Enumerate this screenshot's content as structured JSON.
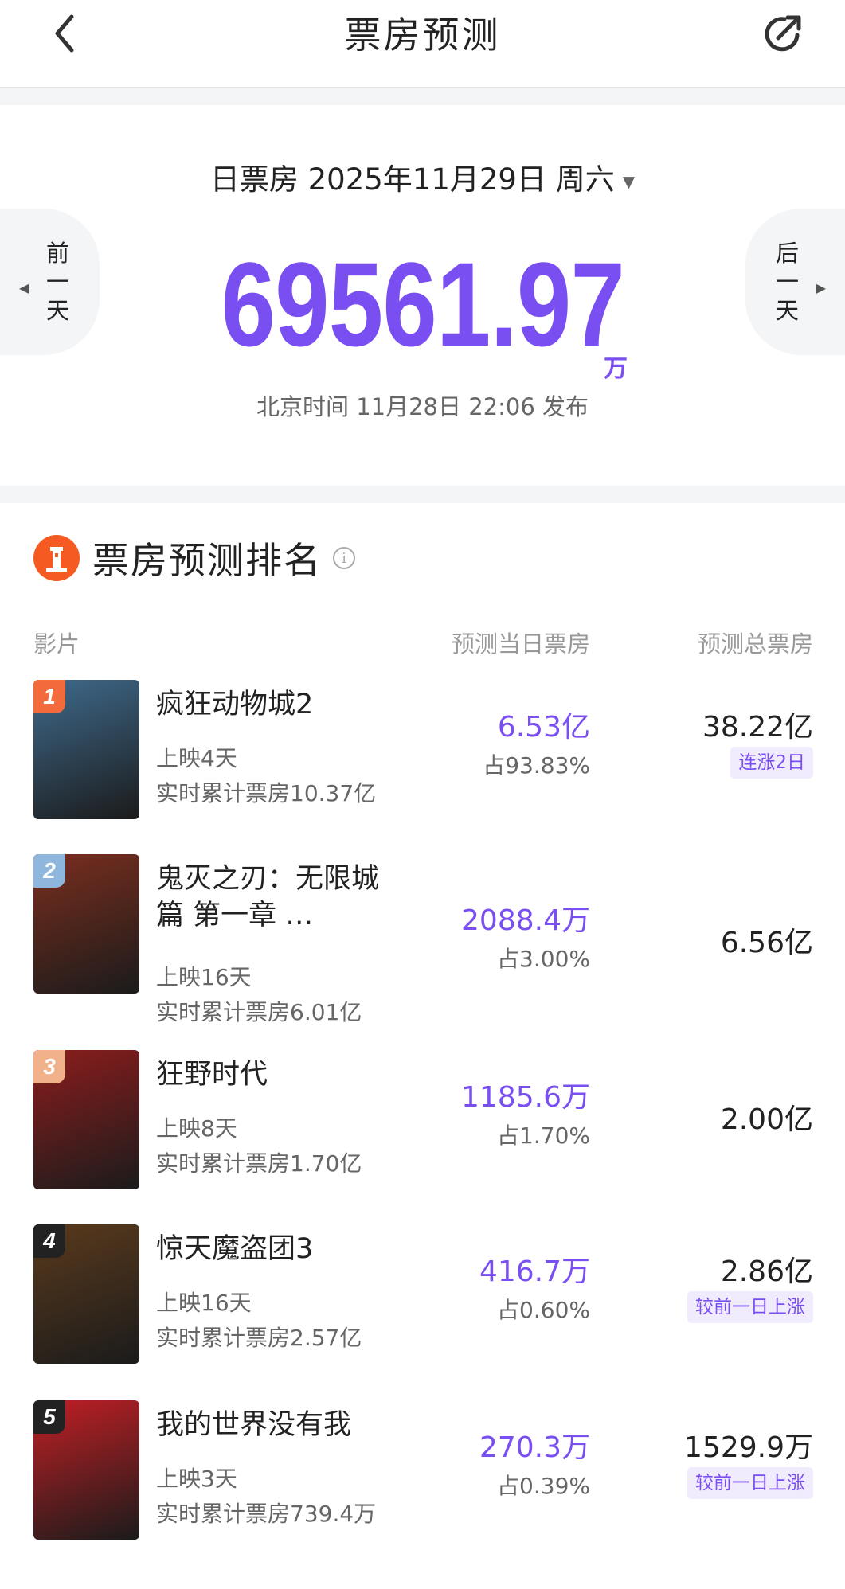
{
  "header": {
    "title": "票房预测"
  },
  "summary": {
    "date": "日票房 2025年11月29日 周六",
    "value": "69561.97",
    "unit": "万",
    "publish": "北京时间 11月28日 22:06 发布",
    "prev_day": [
      "前",
      "一",
      "天"
    ],
    "next_day": [
      "后",
      "一",
      "天"
    ]
  },
  "ranking": {
    "title": "票房预测排名",
    "columns": {
      "film": "影片",
      "day": "预测当日票房",
      "total": "预测总票房"
    },
    "films": [
      {
        "rank": "1",
        "name": "疯狂动物城2",
        "days": "上映4天",
        "cumulative": "实时累计票房10.37亿",
        "day_value": "6.53亿",
        "day_pct": "占93.83%",
        "total": "38.22亿",
        "tag": "连涨2日",
        "badge_color": "#f36b3c",
        "poster_color": "#3f6a8c"
      },
      {
        "rank": "2",
        "name": "鬼灭之刃：无限城篇 第一章 …",
        "days": "上映16天",
        "cumulative": "实时累计票房6.01亿",
        "day_value": "2088.4万",
        "day_pct": "占3.00%",
        "total": "6.56亿",
        "tag": "",
        "badge_color": "#8fb6dd",
        "poster_color": "#7a2e1e"
      },
      {
        "rank": "3",
        "name": "狂野时代",
        "days": "上映8天",
        "cumulative": "实时累计票房1.70亿",
        "day_value": "1185.6万",
        "day_pct": "占1.70%",
        "total": "2.00亿",
        "tag": "",
        "badge_color": "#f0b18b",
        "poster_color": "#8c1d1d"
      },
      {
        "rank": "4",
        "name": "惊天魔盗团3",
        "days": "上映16天",
        "cumulative": "实时累计票房2.57亿",
        "day_value": "416.7万",
        "day_pct": "占0.60%",
        "total": "2.86亿",
        "tag": "较前一日上涨",
        "badge_color": "#222222",
        "poster_color": "#5a3a1c"
      },
      {
        "rank": "5",
        "name": "我的世界没有我",
        "days": "上映3天",
        "cumulative": "实时累计票房739.4万",
        "day_value": "270.3万",
        "day_pct": "占0.39%",
        "total": "1529.9万",
        "tag": "较前一日上涨",
        "badge_color": "#222222",
        "poster_color": "#c11f24"
      }
    ]
  },
  "colors": {
    "accent": "#7a4ff2",
    "brand_orange": "#f45a22"
  },
  "icons": {
    "back": "chevron-left-icon",
    "share": "share-icon",
    "logo": "lighthouse-icon",
    "info": "info-icon"
  }
}
